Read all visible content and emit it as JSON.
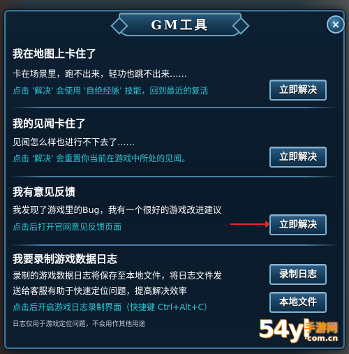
{
  "dialog": {
    "title": "GM工具",
    "close_label": "×"
  },
  "sections": [
    {
      "title": "我在地图上卡住了",
      "desc": "卡在场景里，跑不出来，轻功也跳不出来……",
      "hint": "点击 '解决' 会使用 '自绝经脉' 技能，回到最近的复活",
      "button": "立即解决"
    },
    {
      "title": "我的见闻卡住了",
      "desc": "见闻怎么样也进行不下去了……",
      "hint": "点击 '解决' 会重置你当前在游戏中所处的见闻。",
      "button": "立即解决"
    },
    {
      "title": "我有意见反馈",
      "desc": "我发现了游戏里的Bug，我有一个很好的游戏改进建议",
      "hint": "点击后打开官网意见反馈页面",
      "button": "立即解决"
    },
    {
      "title": "我要录制游戏数据日志",
      "desc_line1": "录制的游戏数据日志将保存至本地文件，将日志文件发",
      "desc_line2": "送给客服有助于快速定位问题，提高解决效率",
      "hint": "点击后开启游戏日志录制界面（快捷键 Ctrl+Alt+C）",
      "note": "日志仅用于游戏定位问题，不会用作其他用途",
      "button_record": "录制日志",
      "button_local": "本地文件"
    }
  ],
  "watermark": {
    "main": "54yl",
    "site": "手游网",
    "domain": "·com.cn"
  },
  "colors": {
    "hint": "#2ec7d6",
    "arrow": "#e0282c",
    "watermark": "#f39a1a"
  }
}
